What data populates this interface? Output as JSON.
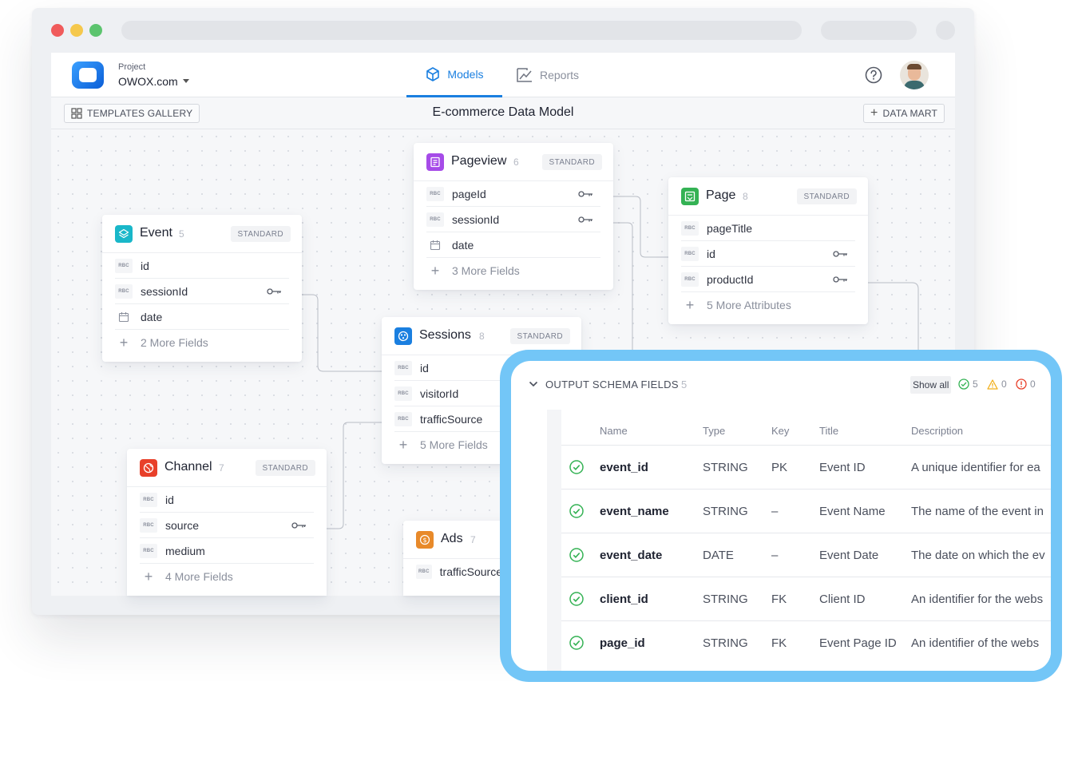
{
  "browser": {
    "dots": [
      "#f05b5b",
      "#f5c84c",
      "#5cc46e"
    ]
  },
  "header": {
    "project_label": "Project",
    "project_name": "OWOX.com",
    "tabs": [
      {
        "label": "Models",
        "active": true
      },
      {
        "label": "Reports",
        "active": false
      }
    ],
    "help_icon": "help-circle-icon",
    "avatar": "user-avatar"
  },
  "toolbar": {
    "templates_label": "TEMPLATES GALLERY",
    "model_title": "E-commerce Data Model",
    "data_mart_label": "DATA MART"
  },
  "entities": {
    "pageview": {
      "title": "Pageview",
      "count": "6",
      "badge": "STANDARD",
      "color": "#a64be8",
      "fields": [
        {
          "type": "RBC",
          "name": "pageId"
        },
        {
          "type": "RBC",
          "name": "sessionId"
        },
        {
          "type": "calendar",
          "name": "date"
        }
      ],
      "more": "3 More Fields"
    },
    "page": {
      "title": "Page",
      "count": "8",
      "badge": "STANDARD",
      "color": "#34b254",
      "fields": [
        {
          "type": "RBC",
          "name": "pageTitle"
        },
        {
          "type": "RBC",
          "name": "id"
        },
        {
          "type": "RBC",
          "name": "productId"
        }
      ],
      "more": "5 More Attributes"
    },
    "event": {
      "title": "Event",
      "count": "5",
      "badge": "STANDARD",
      "color": "#19b7c9",
      "fields": [
        {
          "type": "RBC",
          "name": "id"
        },
        {
          "type": "RBC",
          "name": "sessionId"
        },
        {
          "type": "calendar",
          "name": "date"
        }
      ],
      "more": "2 More Fields"
    },
    "sessions": {
      "title": "Sessions",
      "count": "8",
      "badge": "STANDARD",
      "color": "#1a7fe0",
      "fields": [
        {
          "type": "RBC",
          "name": "id"
        },
        {
          "type": "RBC",
          "name": "visitorId"
        },
        {
          "type": "RBC",
          "name": "trafficSource"
        }
      ],
      "more": "5 More Fields"
    },
    "channel": {
      "title": "Channel",
      "count": "7",
      "badge": "STANDARD",
      "color": "#e8402a",
      "fields": [
        {
          "type": "RBC",
          "name": "id"
        },
        {
          "type": "RBC",
          "name": "source"
        },
        {
          "type": "RBC",
          "name": "medium"
        }
      ],
      "more": "4 More Fields"
    },
    "ads": {
      "title": "Ads",
      "count": "7",
      "color": "#e88a2a",
      "fields": [
        {
          "type": "RBC",
          "name": "trafficSource"
        }
      ]
    }
  },
  "schema": {
    "title": "OUTPUT SCHEMA FIELDS",
    "count": "5",
    "show_all": "Show all",
    "ok_count": "5",
    "warn_count": "0",
    "error_count": "0",
    "columns": [
      "Name",
      "Type",
      "Key",
      "Title",
      "Description"
    ],
    "rows": [
      {
        "name": "event_id",
        "type": "STRING",
        "key": "PK",
        "title": "Event ID",
        "description": "A unique identifier for ea"
      },
      {
        "name": "event_name",
        "type": "STRING",
        "key": "–",
        "title": "Event Name",
        "description": "The name of the event in"
      },
      {
        "name": "event_date",
        "type": "DATE",
        "key": "–",
        "title": "Event Date",
        "description": "The date on which the ev"
      },
      {
        "name": "client_id",
        "type": "STRING",
        "key": "FK",
        "title": "Client ID",
        "description": "An identifier for the webs"
      },
      {
        "name": "page_id",
        "type": "STRING",
        "key": "FK",
        "title": "Event Page ID",
        "description": "An identifier of the webs"
      }
    ]
  }
}
